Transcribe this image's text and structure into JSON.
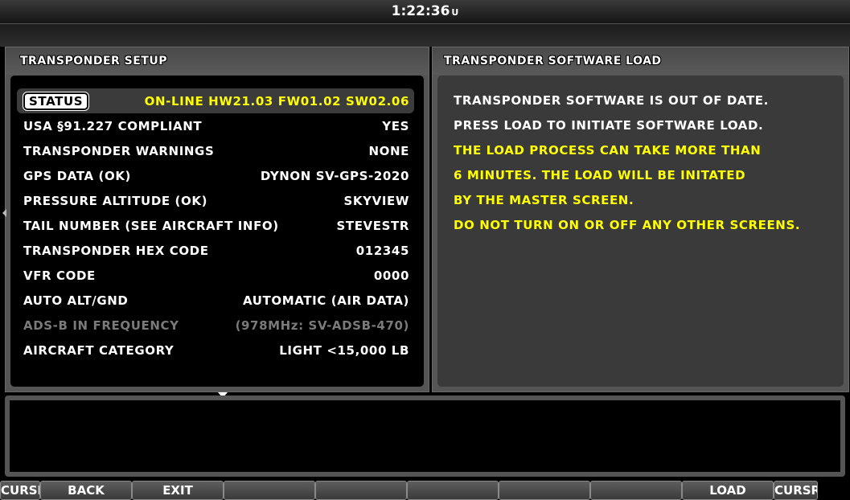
{
  "top_bar": {
    "time": "1:22:36",
    "time_suffix": "U"
  },
  "left_panel": {
    "title": "TRANSPONDER SETUP",
    "status_badge": "STATUS",
    "status_value": "ON-LINE HW21.03 FW01.02 SW02.06",
    "rows": [
      {
        "label": "USA §91.227 COMPLIANT",
        "value": "YES"
      },
      {
        "label": "TRANSPONDER WARNINGS",
        "value": "NONE"
      },
      {
        "label": "GPS DATA (OK)",
        "value": "DYNON SV-GPS-2020"
      },
      {
        "label": "PRESSURE ALTITUDE (OK)",
        "value": "SKYVIEW"
      },
      {
        "label": "TAIL NUMBER (SEE AIRCRAFT INFO)",
        "value": "STEVESTR"
      },
      {
        "label": "TRANSPONDER HEX CODE",
        "value": "012345"
      },
      {
        "label": "VFR CODE",
        "value": "0000"
      },
      {
        "label": "AUTO ALT/GND",
        "value": "AUTOMATIC (AIR DATA)"
      },
      {
        "label": "ADS-B IN FREQUENCY",
        "value": "(978MHz: SV-ADSB-470)"
      },
      {
        "label": "AIRCRAFT CATEGORY",
        "value": "LIGHT <15,000 LB"
      }
    ]
  },
  "right_panel": {
    "title": "TRANSPONDER SOFTWARE LOAD",
    "lines": [
      "TRANSPONDER SOFTWARE IS OUT OF DATE.",
      "PRESS LOAD TO INITIATE SOFTWARE LOAD.",
      "THE LOAD PROCESS CAN TAKE MORE THAN",
      "6 MINUTES. THE LOAD WILL BE INITATED",
      "BY THE MASTER SCREEN.",
      "DO NOT TURN ON OR OFF ANY OTHER SCREENS."
    ]
  },
  "softkeys": [
    "CURSR",
    "BACK",
    "EXIT",
    "",
    "",
    "",
    "",
    "",
    "LOAD",
    "CURSR"
  ],
  "colors": {
    "highlight_text": "#ffff00",
    "disabled_text": "#7a7a7a",
    "panel_gray": "#555555"
  },
  "icons": [
    "scroll-down-arrow-icon"
  ]
}
